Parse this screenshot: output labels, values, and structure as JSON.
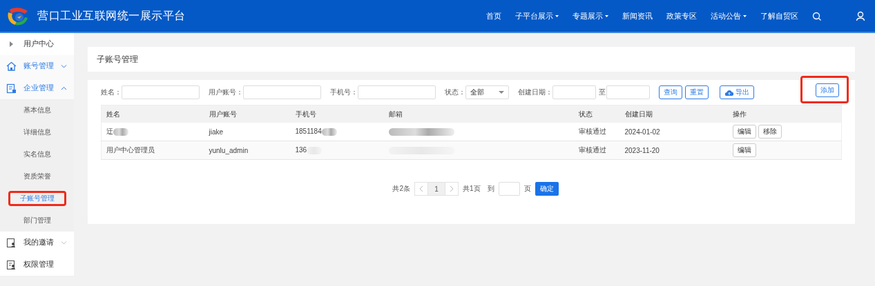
{
  "header": {
    "title": "营口工业互联网统一展示平台",
    "nav": [
      {
        "label": "首页",
        "dropdown": false
      },
      {
        "label": "子平台展示",
        "dropdown": true
      },
      {
        "label": "专题展示",
        "dropdown": true
      },
      {
        "label": "新闻资讯",
        "dropdown": false
      },
      {
        "label": "政策专区",
        "dropdown": false
      },
      {
        "label": "活动公告",
        "dropdown": true
      },
      {
        "label": "了解自贸区",
        "dropdown": false
      }
    ]
  },
  "sidebar": {
    "items": [
      {
        "label": "用户中心",
        "kind": "link",
        "active": false
      },
      {
        "label": "账号管理",
        "kind": "group",
        "active": true,
        "expanded": false
      },
      {
        "label": "企业管理",
        "kind": "group",
        "active": true,
        "expanded": true,
        "children": [
          {
            "label": "基本信息",
            "selected": false,
            "highlighted": false
          },
          {
            "label": "详细信息",
            "selected": false,
            "highlighted": false
          },
          {
            "label": "实名信息",
            "selected": false,
            "highlighted": false
          },
          {
            "label": "资质荣誉",
            "selected": false,
            "highlighted": false
          },
          {
            "label": "子账号管理",
            "selected": true,
            "highlighted": true
          },
          {
            "label": "部门管理",
            "selected": false,
            "highlighted": false
          }
        ]
      },
      {
        "label": "我的邀请",
        "kind": "group",
        "active": false,
        "expanded": false
      },
      {
        "label": "权限管理",
        "kind": "link",
        "active": false
      }
    ]
  },
  "page_title": "子账号管理",
  "filters": [
    {
      "kind": "text",
      "label": "姓名："
    },
    {
      "kind": "text",
      "label": "用户账号："
    },
    {
      "kind": "text",
      "label": "手机号："
    },
    {
      "kind": "select",
      "label": "状态：",
      "value": "全部"
    },
    {
      "kind": "daterange",
      "label": "创建日期：",
      "separator": "至"
    }
  ],
  "actions": [
    {
      "label": "查询",
      "kind": "plain"
    },
    {
      "label": "重置",
      "kind": "plain"
    },
    {
      "label": "导出",
      "kind": "export"
    }
  ],
  "add_button": {
    "label": "添加",
    "highlighted": true
  },
  "table": {
    "columns": [
      "姓名",
      "用户账号",
      "手机号",
      "邮箱",
      "状态",
      "创建日期",
      "操作"
    ],
    "rows": [
      {
        "cells": [
          {
            "text": "迂",
            "redacted": true
          },
          {
            "text": "jiake",
            "redacted": false
          },
          {
            "text": "1851184",
            "redacted": true
          },
          {
            "redacted": true
          },
          {
            "text": "审核通过",
            "redacted": false
          },
          {
            "text": "2024-01-02",
            "redacted": false
          }
        ],
        "actions": [
          "编辑",
          "移除"
        ]
      },
      {
        "cells": [
          {
            "text": "用户中心管理员",
            "redacted": false
          },
          {
            "text": "yunlu_admin",
            "redacted": false
          },
          {
            "text": "136",
            "redacted": true
          },
          {
            "redacted": true
          },
          {
            "text": "审核通过",
            "redacted": false
          },
          {
            "text": "2023-11-20",
            "redacted": false
          }
        ],
        "actions": [
          "编辑"
        ]
      }
    ]
  },
  "pagination": {
    "total": "共2条",
    "pages": [
      {
        "label": "1",
        "selected": true
      }
    ],
    "page_count": "共1页",
    "goto_label": "到",
    "page_unit": "页",
    "confirm": "确定"
  }
}
